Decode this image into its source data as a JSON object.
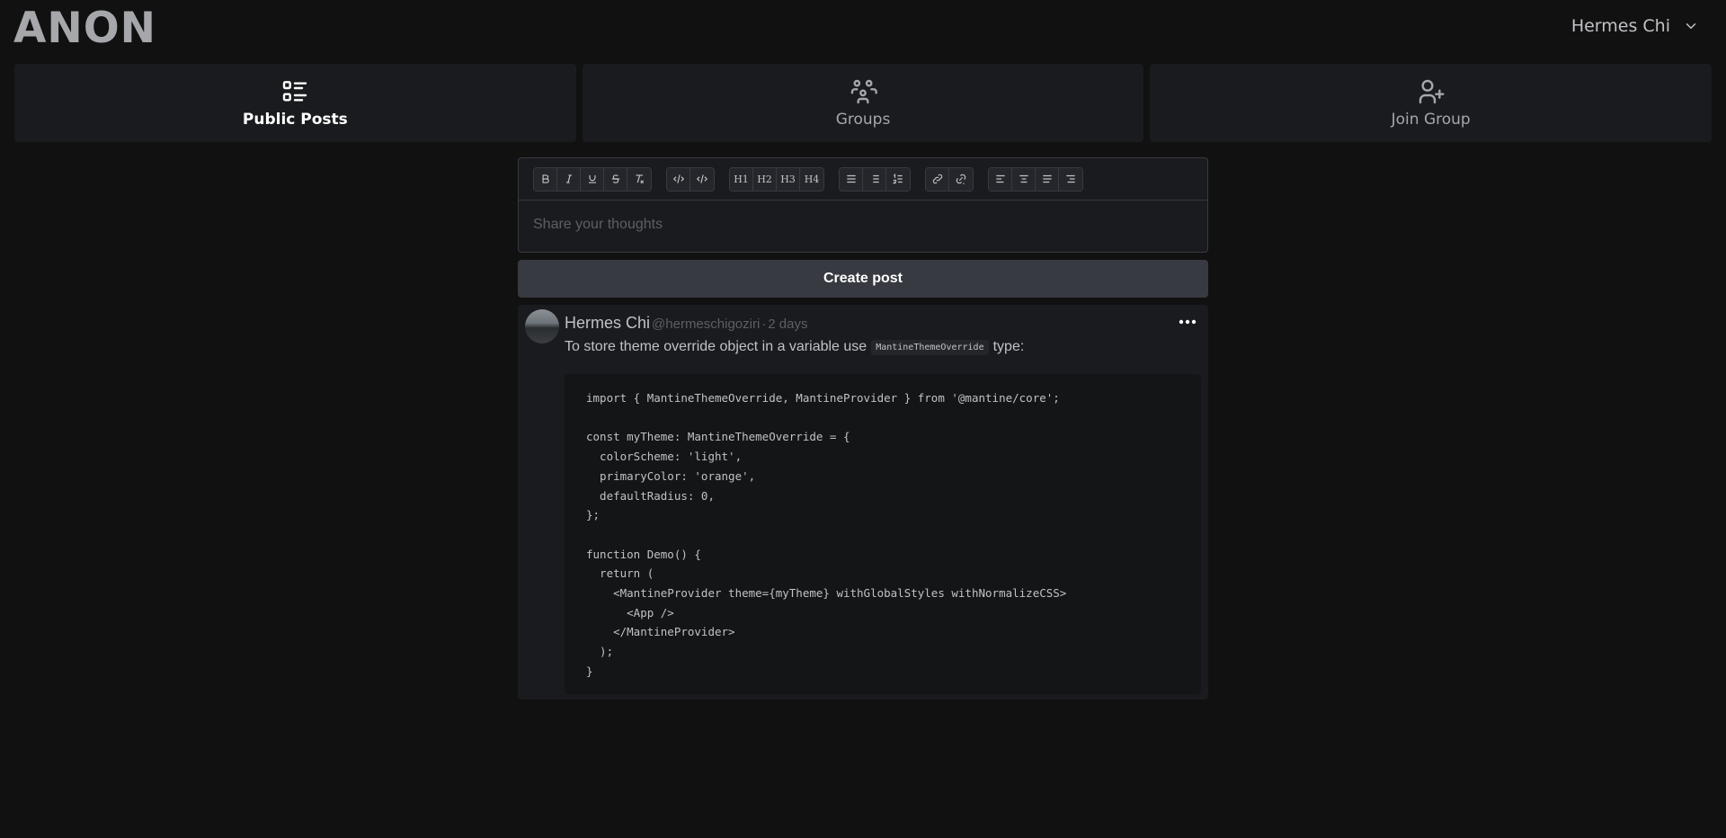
{
  "app": {
    "logo": "ANON"
  },
  "user_menu": {
    "name": "Hermes Chi"
  },
  "nav": {
    "tabs": [
      {
        "label": "Public Posts",
        "icon": "list-details-icon",
        "active": true
      },
      {
        "label": "Groups",
        "icon": "users-group-icon",
        "active": false
      },
      {
        "label": "Join Group",
        "icon": "user-plus-icon",
        "active": false
      }
    ]
  },
  "editor": {
    "toolbar": {
      "headings": [
        "H1",
        "H2",
        "H3",
        "H4"
      ]
    },
    "placeholder": "Share your thoughts"
  },
  "create_button": {
    "label": "Create post"
  },
  "post": {
    "author": "Hermes Chi",
    "handle": "@hermeschigoziri",
    "separator": "·",
    "time": "2 days",
    "text_before": "To store theme override object in a variable use",
    "inline_code": "MantineThemeOverride",
    "text_after": "type:",
    "code": "import { MantineThemeOverride, MantineProvider } from '@mantine/core';\n\nconst myTheme: MantineThemeOverride = {\n  colorScheme: 'light',\n  primaryColor: 'orange',\n  defaultRadius: 0,\n};\n\nfunction Demo() {\n  return (\n    <MantineProvider theme={myTheme} withGlobalStyles withNormalizeCSS>\n      <App />\n    </MantineProvider>\n  );\n}"
  }
}
